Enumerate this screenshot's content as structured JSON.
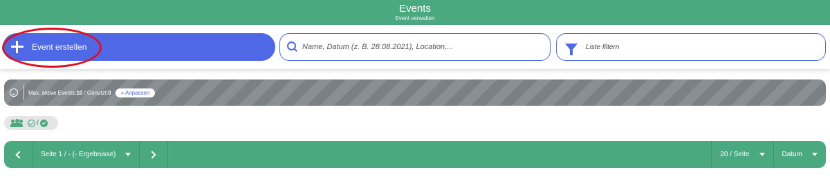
{
  "header": {
    "title": "Events",
    "subtitle": "Event verwalten"
  },
  "toolbar": {
    "create_label": "Event erstellen",
    "search_placeholder": "Name, Datum (z. B. 28.08.2021), Location,...",
    "search_value": "",
    "filter_label": "Liste filtern"
  },
  "limits": {
    "label_prefix": "Max. aktive Events:",
    "max_active": "10",
    "label_used": " / Genutzt:",
    "used": "0",
    "adjust_label": "» Anpassen"
  },
  "participants": {
    "separator": "/"
  },
  "pager": {
    "page_label": "Seite 1 / - (- Ergebnisse)",
    "page_size_label": "20 / Seite",
    "sort_label": "Datum"
  },
  "colors": {
    "brand_green": "#4aa97e",
    "accent_blue": "#4f69e6",
    "highlight_red": "#e0101e",
    "banner_gray": "#7b8085"
  },
  "icons": {
    "create": "plus-icon",
    "search": "search-icon",
    "filter": "filter-icon",
    "limits": "smiley-icon",
    "participants": "people-icon",
    "check_outline": "check-circle-outline-icon",
    "check_filled": "check-circle-filled-icon",
    "prev": "chevron-left-icon",
    "next": "chevron-right-icon",
    "dropdown": "caret-down-icon"
  }
}
